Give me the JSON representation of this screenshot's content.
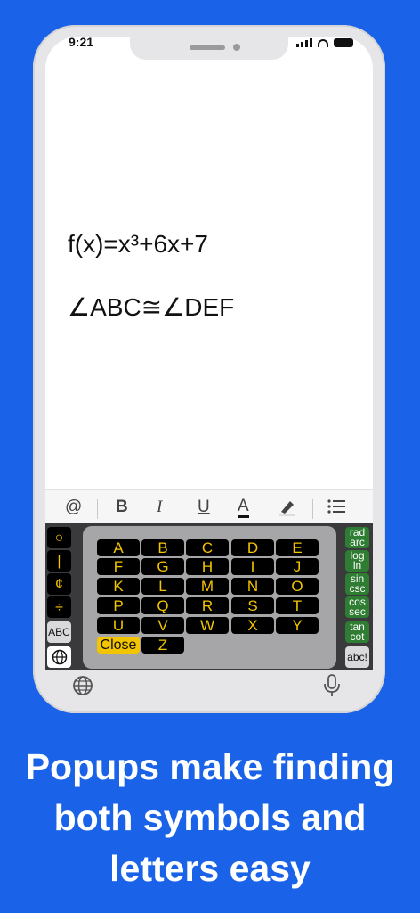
{
  "status": {
    "time": "9:21"
  },
  "editor": {
    "line1": "f(x)=x³+6x+7",
    "line2": "∠ABC≅∠DEF"
  },
  "toolbar": {
    "at": "@",
    "bold": "B",
    "italic": "I",
    "underline": "U",
    "text_color": "A",
    "highlight_icon": "highlighter-icon",
    "list_icon": "list-icon"
  },
  "keyboard": {
    "left_keys": [
      "○",
      "|",
      "¢",
      "÷",
      "ABC"
    ],
    "globe_icon": "globe-icon",
    "right_keys": [
      "rad arc",
      "log ln",
      "sin csc",
      "cos sec",
      "tan cot",
      "abc!"
    ],
    "popup_keys": [
      "A",
      "B",
      "C",
      "D",
      "E",
      "F",
      "G",
      "H",
      "I",
      "J",
      "K",
      "L",
      "M",
      "N",
      "O",
      "P",
      "Q",
      "R",
      "S",
      "T",
      "U",
      "V",
      "W",
      "X",
      "Y",
      "Z"
    ],
    "close_label": "Close",
    "accent": "#f3c400",
    "green": "#2e7d32"
  },
  "bottom_bar": {
    "globe_icon": "globe-icon",
    "mic_icon": "microphone-icon"
  },
  "caption": [
    "Popups make finding",
    "both symbols and",
    "letters easy"
  ]
}
